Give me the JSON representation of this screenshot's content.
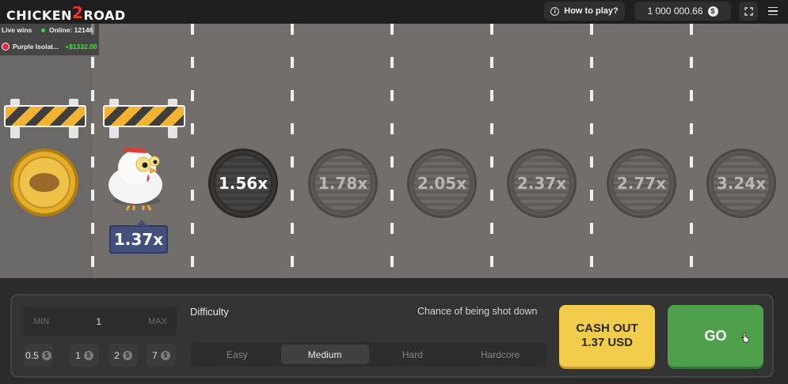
{
  "header": {
    "logo_left": "CHICKEN",
    "logo_mid": "2",
    "logo_right": "ROAD",
    "how_to_play": "How to play?",
    "balance": "1 000 000.66",
    "currency_symbol": "$"
  },
  "live": {
    "label": "Live wins",
    "online": "Online: 12146",
    "recent_player": "Purple Isolat...",
    "recent_win": "+$1332.00"
  },
  "road": {
    "current_multiplier": "1.37x",
    "lanes": [
      "1.56x",
      "1.78x",
      "2.05x",
      "2.37x",
      "2.77x",
      "3.24x"
    ]
  },
  "controls": {
    "min_label": "MIN",
    "bet_value": "1",
    "max_label": "MAX",
    "quick_bets": [
      "0.5",
      "1",
      "2",
      "7"
    ],
    "difficulty_label": "Difficulty",
    "chance_label": "Chance of being shot down",
    "difficulties": [
      "Easy",
      "Medium",
      "Hard",
      "Hardcore"
    ],
    "selected_difficulty": "Medium",
    "cashout_line1": "CASH OUT",
    "cashout_line2": "1.37 USD",
    "go_label": "GO"
  },
  "colors": {
    "road": "#716e6c",
    "cashout": "#f2cd4c",
    "go": "#4ea14a",
    "multiplier_tag": "#43507e",
    "win_text": "#4ade3b"
  }
}
